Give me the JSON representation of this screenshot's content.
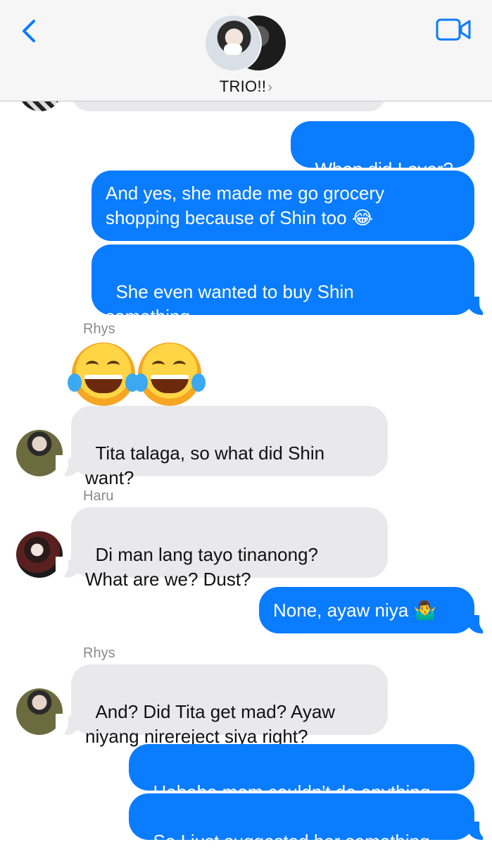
{
  "header": {
    "group_name": "TRIO!!",
    "chevron": "›",
    "back_icon": "chevron-left-icon",
    "video_icon": "video-camera-icon",
    "accent_color": "#0a7cff"
  },
  "messages": [
    {
      "from": "me",
      "text": "When did I ever?"
    },
    {
      "from": "me",
      "text": "And yes, she made me go grocery\nshopping because of Shin too "
    },
    {
      "from": "me",
      "text": "She even wanted to buy Shin\nsomething"
    },
    {
      "from": "Rhys",
      "sender_label": "Rhys",
      "emoji": "😂😂"
    },
    {
      "from": "Rhys",
      "text": "Tita talaga, so what did Shin\nwant?"
    },
    {
      "from": "Haru",
      "sender_label": "Haru",
      "text": "Di man lang tayo tinanong?\nWhat are we? Dust?"
    },
    {
      "from": "me",
      "text": "None, ayaw niya "
    },
    {
      "from": "Rhys",
      "sender_label": "Rhys",
      "text": "And? Did Tita get mad? Ayaw\nniyang nirereject siya right?"
    },
    {
      "from": "me",
      "text": "Hahaha mom couldn't do anything"
    },
    {
      "from": "me",
      "text": "So I just suggested her something"
    }
  ],
  "inline_emojis": {
    "laugh": "😂",
    "shrug": "🤷‍♂️"
  }
}
